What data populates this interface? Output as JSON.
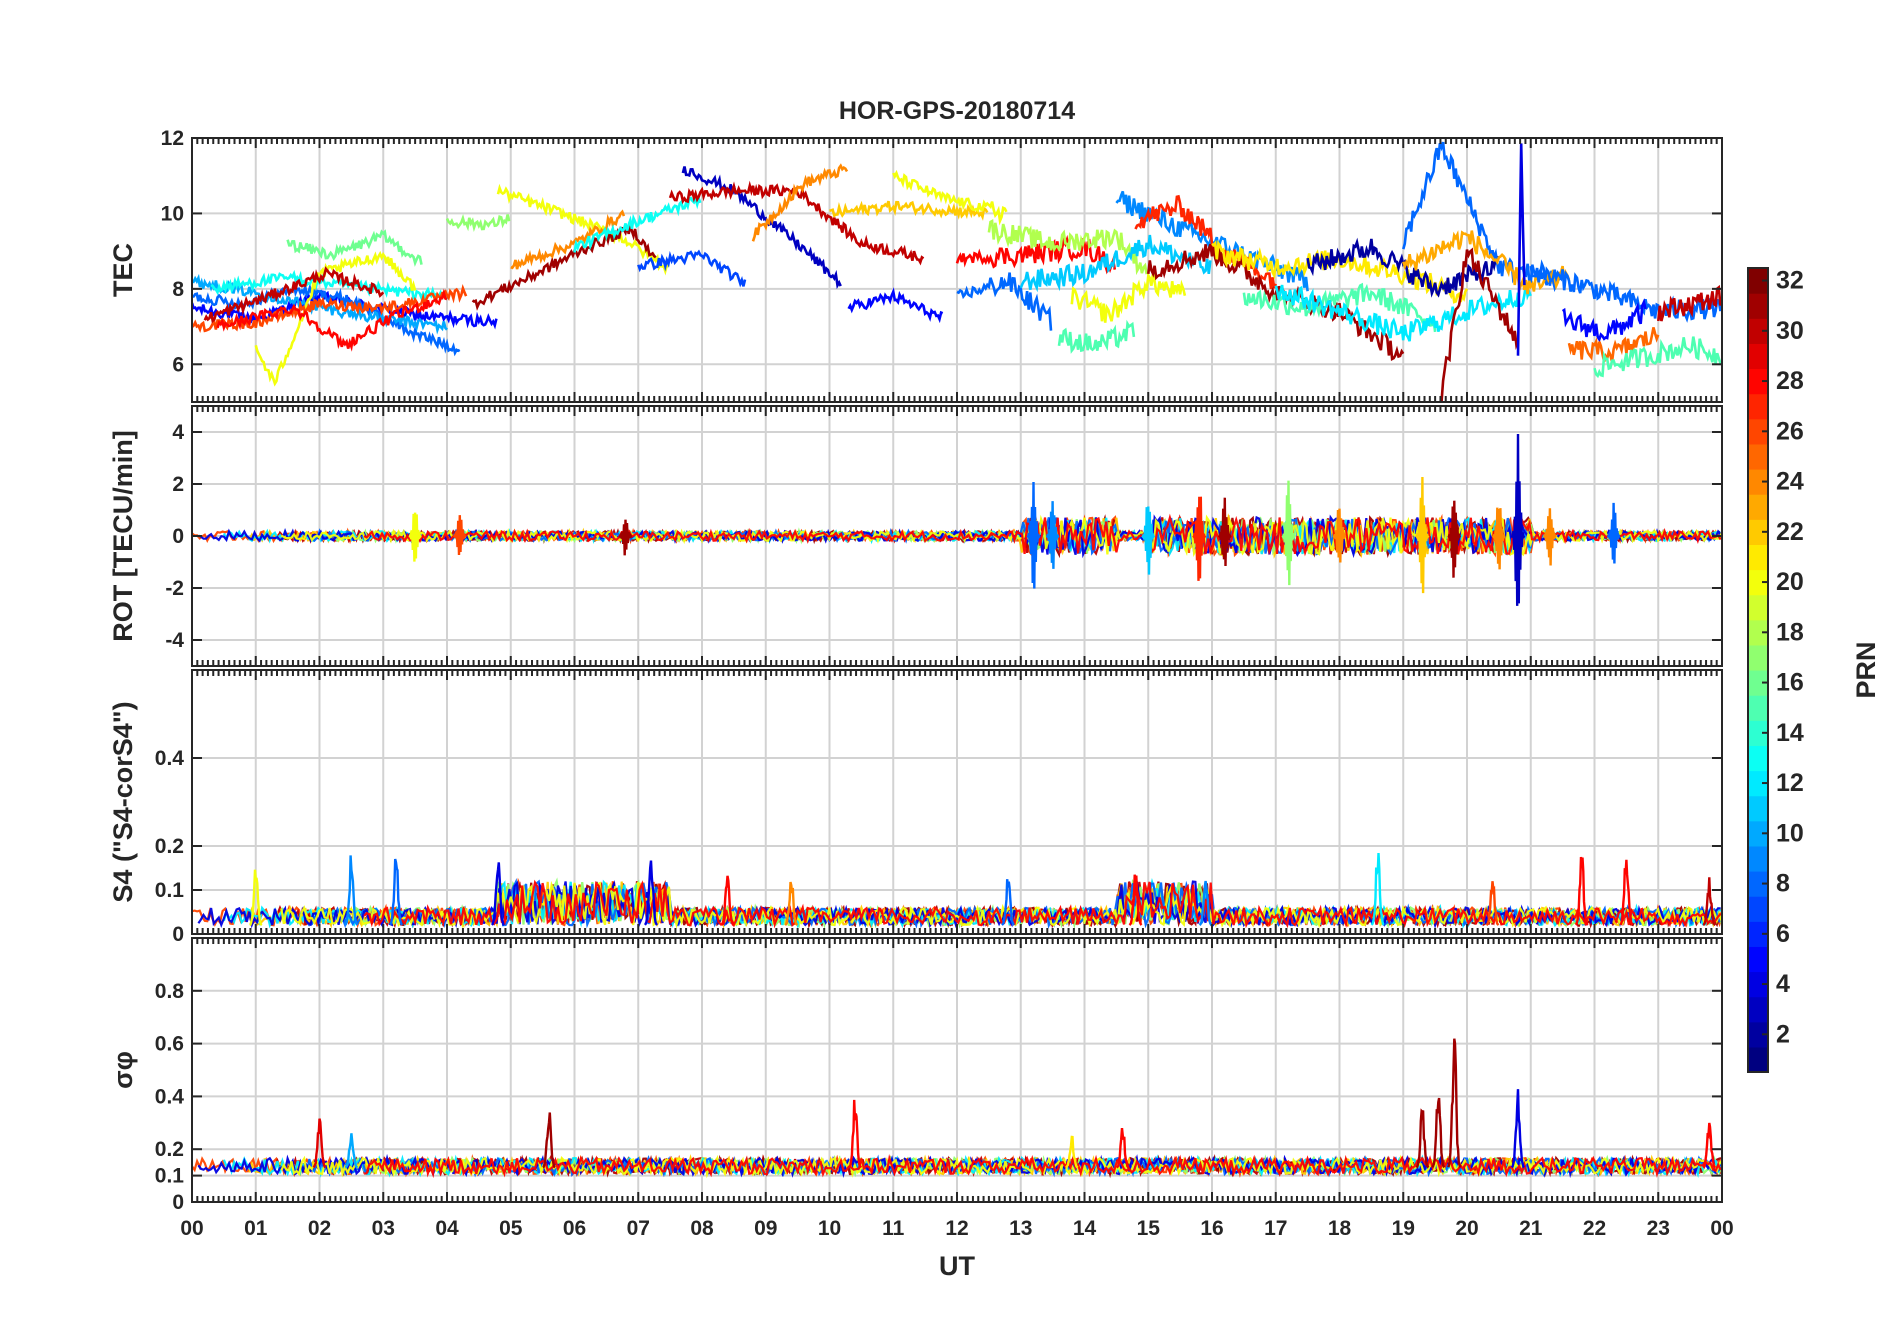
{
  "chart_data": {
    "type": "line",
    "title": "HOR-GPS-20180714",
    "xlabel": "UT",
    "x_ticks": [
      "00",
      "01",
      "02",
      "03",
      "04",
      "05",
      "06",
      "07",
      "08",
      "09",
      "10",
      "11",
      "12",
      "13",
      "14",
      "15",
      "16",
      "17",
      "18",
      "19",
      "20",
      "21",
      "22",
      "23",
      "00"
    ],
    "xlim": [
      0,
      24
    ],
    "grid": true,
    "color_key": "PRN",
    "colorbar": {
      "label": "PRN",
      "range": [
        1,
        32
      ],
      "ticks": [
        "2",
        "4",
        "6",
        "8",
        "10",
        "12",
        "14",
        "16",
        "18",
        "20",
        "22",
        "24",
        "26",
        "28",
        "30",
        "32"
      ],
      "colormap": "jet"
    },
    "panels": [
      {
        "ylabel": "TEC",
        "ylim": [
          5,
          12
        ],
        "y_ticks": [
          "6",
          "8",
          "10",
          "12"
        ],
        "series_level": [
          {
            "prn": 5,
            "x": [
              0,
              1.0,
              2.0,
              3.5,
              4.8
            ],
            "y": [
              7.5,
              7.2,
              7.8,
              7.3,
              7.1
            ]
          },
          {
            "prn": 8,
            "x": [
              0,
              0.8,
              1.6,
              2.5,
              3.5,
              4.2
            ],
            "y": [
              7.8,
              7.6,
              8.0,
              7.7,
              6.8,
              6.4
            ]
          },
          {
            "prn": 10,
            "x": [
              0,
              1.0,
              2.0,
              3.0,
              4.0
            ],
            "y": [
              8.2,
              7.9,
              7.5,
              7.2,
              7.0
            ]
          },
          {
            "prn": 13,
            "x": [
              0.3,
              1.5,
              2.8,
              4.0
            ],
            "y": [
              8.0,
              8.3,
              8.0,
              7.8
            ]
          },
          {
            "prn": 16,
            "x": [
              1.5,
              2.2,
              3.0,
              3.6
            ],
            "y": [
              9.2,
              8.9,
              9.4,
              8.7
            ]
          },
          {
            "prn": 20,
            "x": [
              1.0,
              1.3,
              2.0,
              3.0,
              3.5
            ],
            "y": [
              6.4,
              5.5,
              8.4,
              8.9,
              8.0
            ]
          },
          {
            "prn": 26,
            "x": [
              0,
              1.0,
              2.0,
              3.0,
              4.3
            ],
            "y": [
              7.0,
              7.1,
              7.6,
              7.5,
              7.9
            ]
          },
          {
            "prn": 28,
            "x": [
              0.4,
              1.6,
              2.4,
              3.2,
              4.0
            ],
            "y": [
              7.0,
              7.5,
              6.5,
              7.3,
              7.8
            ]
          },
          {
            "prn": 30,
            "x": [
              0.2,
              1.2,
              2.1,
              3.0
            ],
            "y": [
              7.2,
              7.8,
              8.4,
              7.9
            ]
          },
          {
            "prn": 17,
            "x": [
              4.0,
              4.7,
              5.0
            ],
            "y": [
              9.8,
              9.7,
              9.9
            ]
          },
          {
            "prn": 20,
            "x": [
              4.8,
              5.8,
              6.8,
              7.5
            ],
            "y": [
              10.6,
              10.0,
              9.3,
              8.5
            ]
          },
          {
            "prn": 31,
            "x": [
              4.4,
              5.4,
              6.2,
              6.9,
              7.3
            ],
            "y": [
              7.6,
              8.4,
              9.1,
              9.6,
              8.7
            ]
          },
          {
            "prn": 24,
            "x": [
              5.0,
              6.0,
              6.8
            ],
            "y": [
              8.6,
              9.2,
              10.0
            ]
          },
          {
            "prn": 13,
            "x": [
              6.0,
              7.0,
              8.0
            ],
            "y": [
              9.1,
              9.8,
              10.4
            ]
          },
          {
            "prn": 7,
            "x": [
              7.0,
              8.0,
              8.7
            ],
            "y": [
              8.6,
              8.9,
              8.1
            ]
          },
          {
            "prn": 3,
            "x": [
              7.7,
              8.5,
              9.5,
              10.2
            ],
            "y": [
              11.2,
              10.6,
              9.2,
              8.1
            ]
          },
          {
            "prn": 30,
            "x": [
              7.5,
              8.5,
              9.5,
              10.5,
              11.5
            ],
            "y": [
              10.4,
              10.6,
              10.6,
              9.2,
              8.8
            ]
          },
          {
            "prn": 24,
            "x": [
              8.8,
              9.6,
              10.3
            ],
            "y": [
              9.4,
              10.8,
              11.2
            ]
          },
          {
            "prn": 22,
            "x": [
              10.0,
              11.0,
              12.5
            ],
            "y": [
              10.0,
              10.2,
              10.0
            ]
          },
          {
            "prn": 20,
            "x": [
              11.0,
              11.8,
              12.8
            ],
            "y": [
              11.0,
              10.4,
              10.0
            ]
          },
          {
            "prn": 5,
            "x": [
              10.3,
              11.0,
              11.8
            ],
            "y": [
              7.5,
              7.8,
              7.2
            ]
          },
          {
            "prn": 8,
            "x": [
              12.0,
              12.8,
              13.5
            ],
            "y": [
              7.8,
              8.2,
              7.1
            ]
          },
          {
            "prn": 28,
            "x": [
              12.0,
              13.0,
              14.0,
              14.5
            ],
            "y": [
              8.8,
              8.9,
              9.1,
              8.6
            ]
          },
          {
            "prn": 18,
            "x": [
              12.5,
              13.5,
              14.5,
              15.0
            ],
            "y": [
              9.6,
              9.2,
              9.4,
              8.4
            ]
          },
          {
            "prn": 15,
            "x": [
              13.6,
              14.2,
              14.8
            ],
            "y": [
              6.7,
              6.5,
              6.9
            ]
          },
          {
            "prn": 20,
            "x": [
              13.8,
              14.4,
              15.0,
              15.6
            ],
            "y": [
              7.8,
              7.3,
              8.2,
              7.8
            ]
          },
          {
            "prn": 11,
            "x": [
              13.0,
              14.0,
              15.0,
              16.0
            ],
            "y": [
              8.2,
              8.4,
              9.2,
              8.5
            ]
          },
          {
            "prn": 9,
            "x": [
              14.5,
              15.5,
              16.5,
              17.5
            ],
            "y": [
              10.4,
              9.6,
              8.9,
              8.2
            ]
          },
          {
            "prn": 27,
            "x": [
              14.8,
              15.5,
              16.2,
              17.0
            ],
            "y": [
              9.8,
              10.2,
              9.0,
              8.2
            ]
          },
          {
            "prn": 31,
            "x": [
              15.0,
              16.0,
              17.0,
              18.0,
              19.0
            ],
            "y": [
              8.5,
              9.0,
              7.9,
              7.4,
              6.2
            ]
          },
          {
            "prn": 21,
            "x": [
              16.0,
              17.0,
              18.0,
              19.0,
              20.0
            ],
            "y": [
              9.0,
              8.6,
              8.8,
              8.4,
              7.8
            ]
          },
          {
            "prn": 15,
            "x": [
              16.5,
              17.5,
              18.5,
              19.5
            ],
            "y": [
              7.8,
              7.5,
              7.9,
              7.1
            ]
          },
          {
            "prn": 12,
            "x": [
              17.0,
              18.0,
              19.0,
              20.0,
              21.0
            ],
            "y": [
              8.0,
              7.4,
              6.8,
              7.4,
              7.9
            ]
          },
          {
            "prn": 2,
            "x": [
              17.5,
              18.5,
              19.5,
              20.5
            ],
            "y": [
              8.6,
              9.1,
              8.0,
              8.6
            ]
          },
          {
            "prn": 8,
            "x": [
              19.0,
              19.6,
              20.5,
              21.5
            ],
            "y": [
              9.2,
              11.8,
              8.6,
              8.2
            ]
          },
          {
            "prn": 23,
            "x": [
              19.0,
              20.0,
              21.0,
              21.6
            ],
            "y": [
              8.6,
              9.4,
              8.0,
              8.4
            ]
          },
          {
            "prn": 31,
            "x": [
              19.6,
              20.0,
              20.8
            ],
            "y": [
              5.2,
              9.0,
              6.6
            ]
          },
          {
            "prn": 4,
            "x": [
              20.8,
              20.85,
              20.9
            ],
            "y": [
              6.0,
              12.0,
              8.0
            ]
          },
          {
            "prn": 8,
            "x": [
              21.0,
              22.0,
              23.0,
              24.0
            ],
            "y": [
              8.5,
              8.0,
              7.4,
              7.5
            ]
          },
          {
            "prn": 5,
            "x": [
              21.5,
              22.2,
              22.8
            ],
            "y": [
              7.2,
              6.8,
              7.4
            ]
          },
          {
            "prn": 25,
            "x": [
              21.6,
              22.3,
              23.0
            ],
            "y": [
              6.4,
              6.3,
              6.8
            ]
          },
          {
            "prn": 15,
            "x": [
              22.0,
              22.8,
              23.5,
              24.0
            ],
            "y": [
              5.9,
              6.2,
              6.5,
              6.2
            ]
          },
          {
            "prn": 30,
            "x": [
              23.0,
              23.5,
              24.0
            ],
            "y": [
              7.4,
              7.6,
              7.8
            ]
          }
        ]
      },
      {
        "ylabel": "ROT [TECU/min]",
        "ylim": [
          -5,
          5
        ],
        "y_ticks": [
          "-4",
          "-2",
          "0",
          "2",
          "4"
        ],
        "baseline": 0
      },
      {
        "ylabel": "S4 (\"S4-corS4\")",
        "ylim": [
          0,
          0.6
        ],
        "y_ticks": [
          "0",
          "0.1",
          "0.2",
          "0.4"
        ],
        "baseline": 0.02
      },
      {
        "ylabel": "σφ",
        "ylim": [
          0,
          1
        ],
        "y_ticks": [
          "0",
          "0.1",
          "0.2",
          "0.4",
          "0.6",
          "0.8"
        ],
        "baseline": 0.13
      }
    ],
    "activity_bursts": {
      "note_only_values": true,
      "rot": [
        [
          3.5,
          1.2,
          20
        ],
        [
          4.2,
          1.0,
          26
        ],
        [
          6.8,
          0.9,
          31
        ],
        [
          13.2,
          2.3,
          8
        ],
        [
          13.5,
          1.6,
          9
        ],
        [
          15.0,
          1.8,
          11
        ],
        [
          15.8,
          2.5,
          27
        ],
        [
          16.2,
          1.6,
          31
        ],
        [
          17.2,
          2.2,
          17
        ],
        [
          18.0,
          1.4,
          24
        ],
        [
          19.3,
          2.5,
          22
        ],
        [
          19.8,
          1.9,
          31
        ],
        [
          20.5,
          1.6,
          24
        ],
        [
          20.8,
          4.5,
          3
        ],
        [
          21.3,
          1.4,
          24
        ],
        [
          22.3,
          1.3,
          8
        ]
      ],
      "s4": [
        [
          1.0,
          0.16,
          20
        ],
        [
          2.5,
          0.2,
          9
        ],
        [
          3.2,
          0.2,
          8
        ],
        [
          4.8,
          0.2,
          4
        ],
        [
          7.2,
          0.19,
          4
        ],
        [
          8.4,
          0.15,
          28
        ],
        [
          9.4,
          0.14,
          24
        ],
        [
          12.8,
          0.15,
          8
        ],
        [
          14.8,
          0.16,
          28
        ],
        [
          15.9,
          0.14,
          9
        ],
        [
          18.6,
          0.22,
          12
        ],
        [
          20.4,
          0.14,
          26
        ],
        [
          21.8,
          0.2,
          28
        ],
        [
          22.5,
          0.22,
          28
        ],
        [
          23.8,
          0.13,
          30
        ]
      ],
      "sigma": [
        [
          2.0,
          0.35,
          29
        ],
        [
          2.5,
          0.29,
          10
        ],
        [
          5.6,
          0.37,
          31
        ],
        [
          10.4,
          0.42,
          28
        ],
        [
          13.8,
          0.26,
          21
        ],
        [
          14.6,
          0.31,
          28
        ],
        [
          19.3,
          0.38,
          31
        ],
        [
          19.55,
          0.48,
          31
        ],
        [
          19.8,
          0.69,
          31
        ],
        [
          20.8,
          0.45,
          4
        ],
        [
          23.8,
          0.34,
          28
        ]
      ]
    }
  }
}
